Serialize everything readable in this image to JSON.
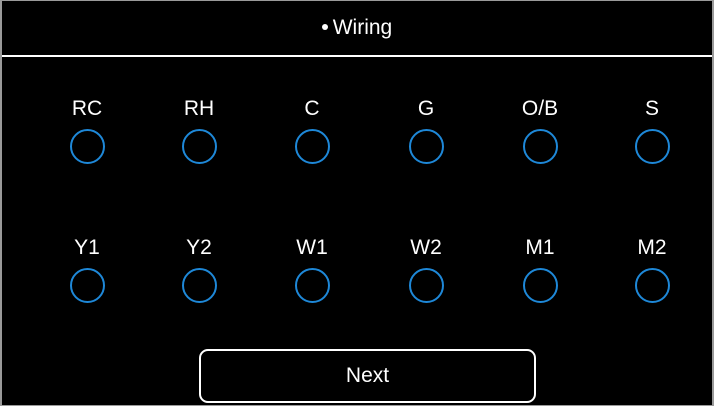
{
  "header": {
    "bullet": "•",
    "title": "Wiring"
  },
  "colors": {
    "background": "#000000",
    "text": "#ffffff",
    "terminal_ring": "#1e88d8"
  },
  "terminals_row1": [
    {
      "label": "RC",
      "selected": false
    },
    {
      "label": "RH",
      "selected": false
    },
    {
      "label": "C",
      "selected": false
    },
    {
      "label": "G",
      "selected": false
    },
    {
      "label": "O/B",
      "selected": false
    },
    {
      "label": "S",
      "selected": false
    }
  ],
  "terminals_row2": [
    {
      "label": "Y1",
      "selected": false
    },
    {
      "label": "Y2",
      "selected": false
    },
    {
      "label": "W1",
      "selected": false
    },
    {
      "label": "W2",
      "selected": false
    },
    {
      "label": "M1",
      "selected": false
    },
    {
      "label": "M2",
      "selected": false
    }
  ],
  "next_button": {
    "label": "Next"
  }
}
